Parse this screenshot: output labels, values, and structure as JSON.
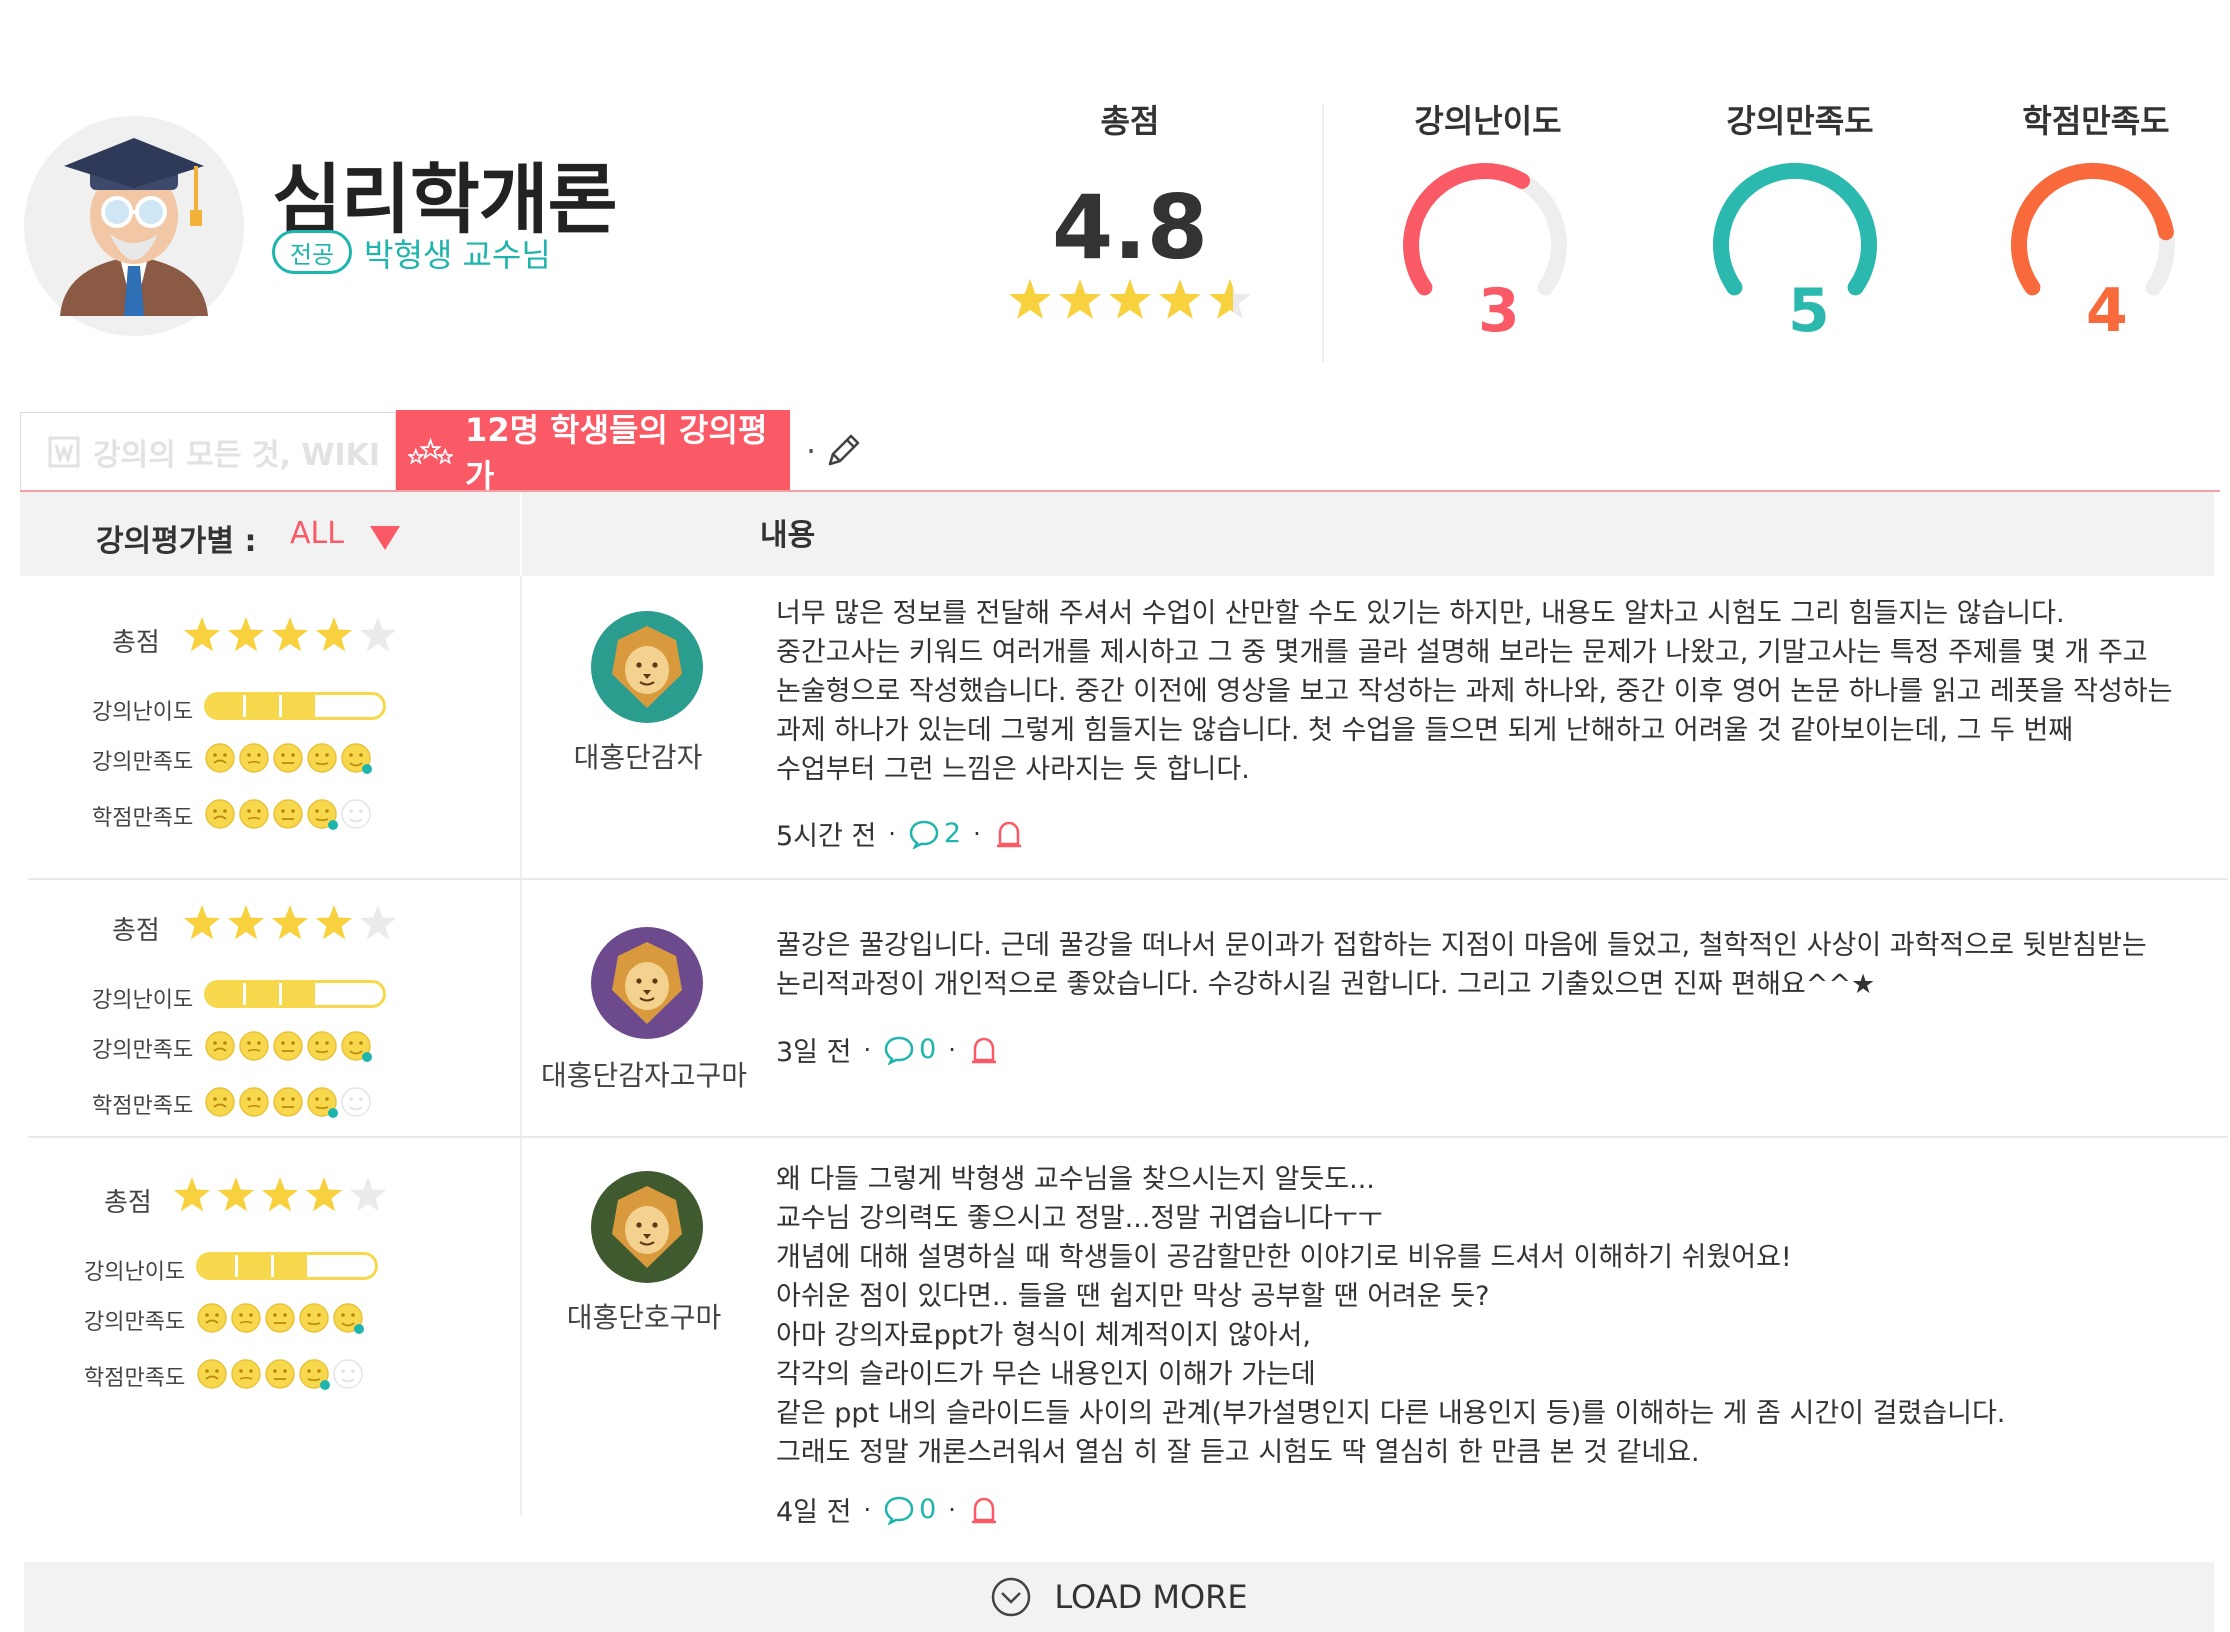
{
  "course": {
    "title": "심리학개론",
    "badge": "전공",
    "professor": "박형생 교수님"
  },
  "summary": {
    "label": "총점",
    "score": "4.8",
    "stars": 4.5
  },
  "gauges": [
    {
      "label": "강의난이도",
      "value": "3",
      "fraction": 0.62,
      "color": "#fa5a66"
    },
    {
      "label": "강의만족도",
      "value": "5",
      "fraction": 1.0,
      "color": "#2bb8ae"
    },
    {
      "label": "학점만족도",
      "value": "4",
      "fraction": 0.82,
      "color": "#f86a3c"
    }
  ],
  "tabs": {
    "wiki": "강의의 모든 것, WIKI",
    "reviews": "12명 학생들의 강의평가",
    "separator": "·"
  },
  "table": {
    "filter_label": "강의평가별 :",
    "filter_value": "ALL",
    "content_header": "내용"
  },
  "labels": {
    "total": "총점",
    "difficulty": "강의난이도",
    "satisfaction": "강의만족도",
    "grade": "학점만족도"
  },
  "reviews": [
    {
      "stars": 4,
      "difficulty": 0.62,
      "satisfaction": 5,
      "grade": 4,
      "avatar_color": "#2a9d8f",
      "nickname": "대홍단감자",
      "text": "너무 많은 정보를 전달해 주셔서 수업이 산만할 수도 있기는 하지만, 내용도 알차고 시험도 그리 힘들지는 않습니다.\n중간고사는 키워드 여러개를 제시하고 그 중 몇개를 골라 설명해 보라는 문제가 나왔고, 기말고사는 특정 주제를 몇 개 주고\n논술형으로 작성했습니다. 중간 이전에 영상을 보고 작성하는 과제 하나와, 중간 이후 영어 논문 하나를 읽고 레폿을 작성하는\n과제 하나가 있는데 그렇게 힘들지는 않습니다. 첫 수업을 들으면 되게 난해하고 어려울 것 같아보이는데, 그 두 번째\n수업부터 그런 느낌은 사라지는 듯 합니다.",
      "time": "5시간 전",
      "comments": "2"
    },
    {
      "stars": 4,
      "difficulty": 0.62,
      "satisfaction": 5,
      "grade": 4,
      "avatar_color": "#6d4a8e",
      "nickname": "대홍단감자고구마",
      "text": "꿀강은 꿀강입니다. 근데 꿀강을 떠나서 문이과가 접합하는 지점이 마음에 들었고, 철학적인 사상이 과학적으로 뒷받침받는\n논리적과정이 개인적으로 좋았습니다. 수강하시길 권합니다. 그리고 기출있으면 진짜 편해요^^★",
      "time": "3일 전",
      "comments": "0"
    },
    {
      "stars": 4,
      "difficulty": 0.62,
      "satisfaction": 5,
      "grade": 4,
      "avatar_color": "#3f5a2e",
      "nickname": "대홍단호구마",
      "text": "왜 다들 그렇게 박형생 교수님을 찾으시는지 알듯도...\n교수님 강의력도 좋으시고 정말...정말 귀엽습니다ㅜㅜ\n개념에 대해 설명하실 때 학생들이 공감할만한 이야기로 비유를 드셔서 이해하기 쉬웠어요!\n아쉬운 점이 있다면.. 들을 땐 쉽지만 막상 공부할 땐 어려운 듯?\n아마 강의자료ppt가 형식이 체계적이지 않아서,\n각각의 슬라이드가 무슨 내용인지 이해가 가는데\n같은 ppt 내의 슬라이드들 사이의 관계(부가설명인지 다른 내용인지 등)를 이해하는 게 좀 시간이 걸렸습니다.\n그래도 정말 개론스러워서 열심 히 잘 듣고 시험도 딱 열심히 한 만큼 본 것 같네요.",
      "time": "4일 전",
      "comments": "0"
    }
  ],
  "load_more": "LOAD MORE",
  "colors": {
    "accent": "#fa5a66",
    "teal": "#1fb5ad",
    "star": "#f7d23e",
    "face": "#f7d84c"
  }
}
